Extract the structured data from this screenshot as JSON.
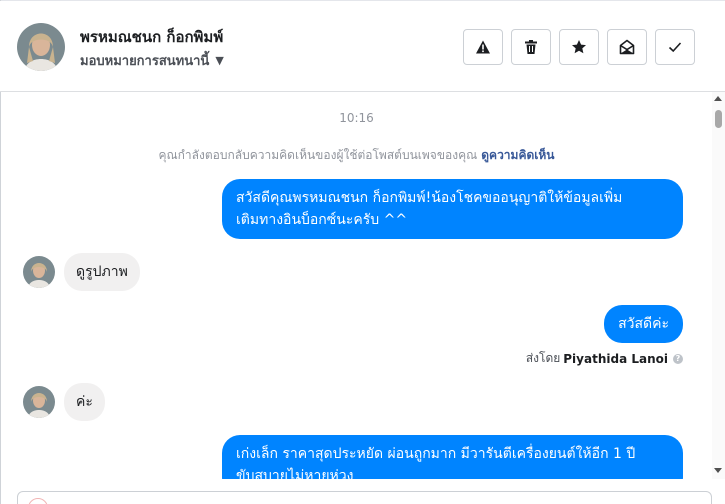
{
  "header": {
    "contact_name": "พรหมณชนก ก็อกพิมพ์",
    "assign_label": "มอบหมายการสนทนานี้",
    "actions": [
      {
        "name": "mark-spam-button",
        "icon": "warning-icon"
      },
      {
        "name": "delete-button",
        "icon": "trash-icon"
      },
      {
        "name": "star-button",
        "icon": "star-icon"
      },
      {
        "name": "mark-unread-button",
        "icon": "envelope-open-icon"
      },
      {
        "name": "mark-done-button",
        "icon": "check-icon"
      }
    ]
  },
  "chat": {
    "timestamp": "10:16",
    "context_text": "คุณกำลังตอบกลับความคิดเห็นของผู้ใช้ต่อโพสต์บนเพจของคุณ",
    "context_link": "ดูความคิดเห็น",
    "messages": [
      {
        "dir": "out",
        "lines": [
          "สวัสดีคุณพรหมณชนก ก็อกพิมพ์!น้องโชคขออนุญาติให้ข้อมูลเพิ่ม",
          "เติมทางอินบ็อกซ์นะครับ ^^"
        ]
      },
      {
        "dir": "in",
        "text": "ดูรูปภาพ"
      },
      {
        "dir": "out",
        "text": "สวัสดีค่ะ"
      },
      {
        "dir": "in",
        "text": "ค่ะ"
      },
      {
        "dir": "out",
        "lines": [
          "เก่งเล็ก ราคาสุดประหยัด ผ่อนถูกมาก มีวารันตีเครื่องยนต์ให้อีก 1 ปี",
          "ขับสบายไม่หายห่วง"
        ]
      }
    ],
    "sent_by_prefix": "ส่งโดย",
    "sent_by_name": "Piyathida Lanoi",
    "info_glyph": "?"
  },
  "colors": {
    "outgoing_bubble": "#0084ff",
    "incoming_bubble": "#f1f0f0",
    "link": "#385898"
  }
}
